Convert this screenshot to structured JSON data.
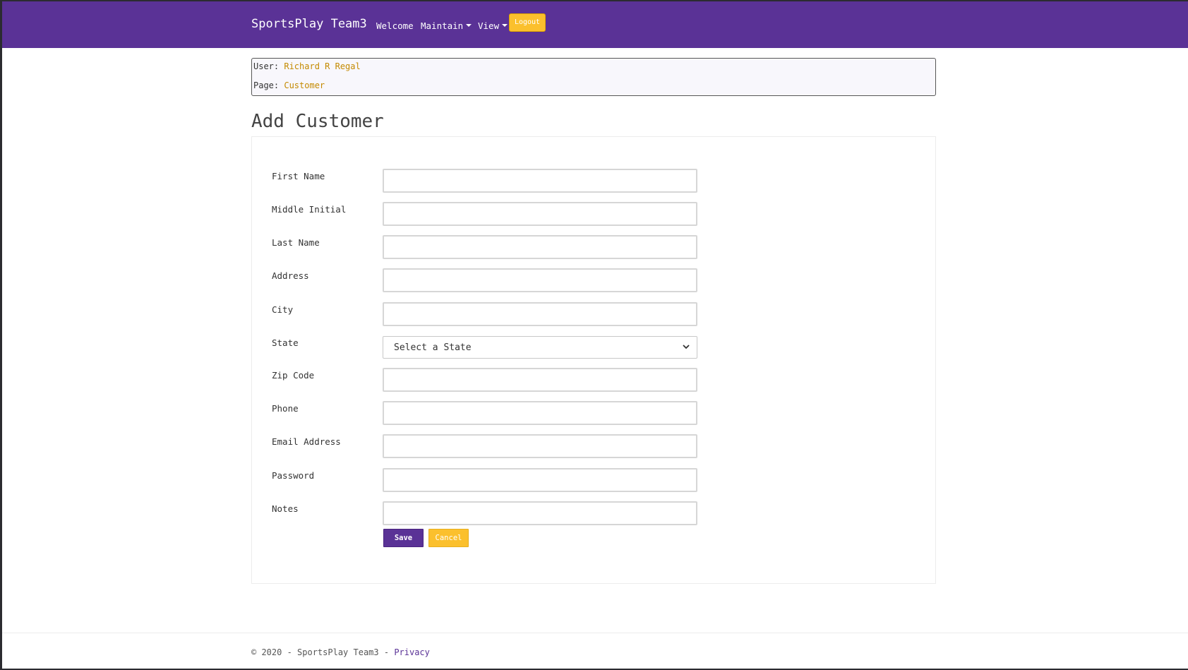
{
  "navbar": {
    "brand": "SportsPlay Team3",
    "links": [
      {
        "label": "Welcome"
      },
      {
        "label": "Maintain"
      },
      {
        "label": "View"
      }
    ],
    "logout_label": "Logout"
  },
  "info": {
    "user_label": "User:",
    "user_value": "Richard R Regal",
    "page_label": "Page:",
    "page_value": "Customer"
  },
  "page_title": "Add Customer",
  "form": {
    "fields": [
      {
        "label": "First Name",
        "value": ""
      },
      {
        "label": "Middle Initial",
        "value": ""
      },
      {
        "label": "Last Name",
        "value": ""
      },
      {
        "label": "Address",
        "value": ""
      },
      {
        "label": "City",
        "value": ""
      },
      {
        "label": "State",
        "value": "Select a State"
      },
      {
        "label": "Zip Code",
        "value": ""
      },
      {
        "label": "Phone",
        "value": ""
      },
      {
        "label": "Email Address",
        "value": ""
      },
      {
        "label": "Password",
        "value": ""
      },
      {
        "label": "Notes",
        "value": ""
      }
    ],
    "save_label": "Save",
    "cancel_label": "Cancel"
  },
  "footer": {
    "text": "© 2020 - SportsPlay Team3 -",
    "privacy_label": "Privacy"
  },
  "colors": {
    "brand_purple": "#5a3296",
    "accent_yellow": "#fbc02d",
    "info_value": "#c48a00"
  },
  "icons": {
    "select_arrow": "chevron-down-icon",
    "dropdown_caret": "caret-down-icon"
  }
}
